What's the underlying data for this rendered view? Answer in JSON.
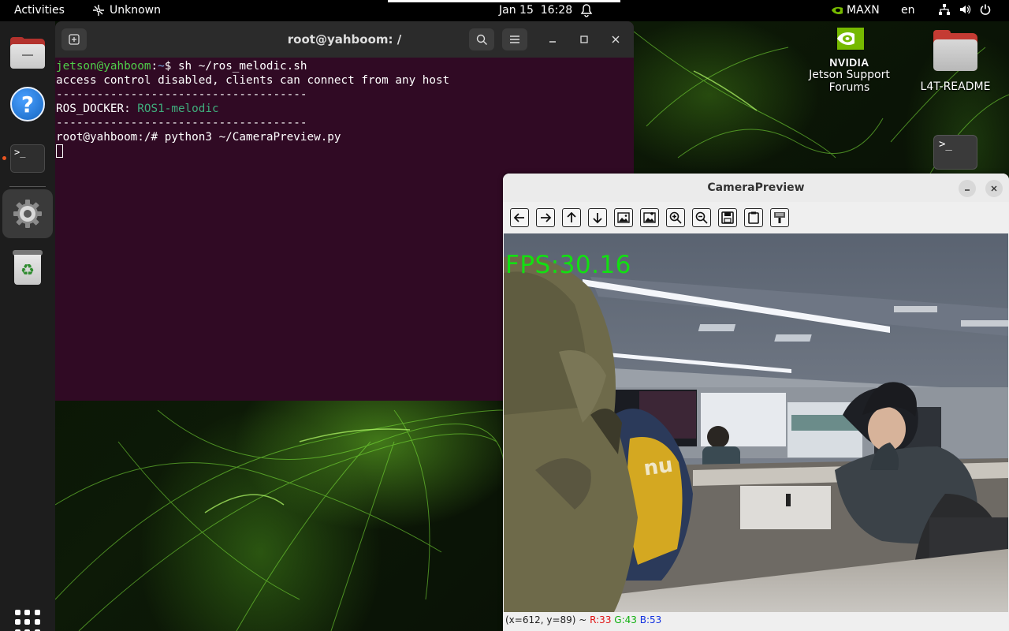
{
  "topbar": {
    "activities": "Activities",
    "network_label": "Unknown",
    "date": "Jan 15",
    "time": "16:28",
    "power_mode": "MAXN",
    "language": "en",
    "icons": [
      "network-icon",
      "bell-icon",
      "nvidia-icon",
      "network-wired-icon",
      "volume-icon",
      "power-icon"
    ]
  },
  "dock": {
    "items": [
      {
        "name": "files",
        "icon": "folder-icon"
      },
      {
        "name": "help",
        "icon": "help-icon"
      },
      {
        "name": "terminal",
        "icon": "terminal-icon",
        "running": true
      },
      {
        "name": "settings",
        "icon": "gear-icon",
        "running": true,
        "active": true
      },
      {
        "name": "trash",
        "icon": "trash-icon"
      }
    ],
    "apps_icon": "show-applications-icon"
  },
  "desktop": {
    "icons": [
      {
        "label_line1": "Jetson Support",
        "label_line2": "Forums",
        "logo_text": "NVIDIA",
        "icon": "nvidia-icon"
      },
      {
        "label": "L4T-README",
        "icon": "folder-icon"
      },
      {
        "label": "",
        "icon": "terminal-icon"
      }
    ]
  },
  "terminal": {
    "title": "root@yahboom: /",
    "lines": {
      "l1_user": "jetson@yahboom",
      "l1_sep": ":",
      "l1_path": "~",
      "l1_cmd": "$ sh ~/ros_melodic.sh",
      "l2": "access control disabled, clients can connect from any host",
      "l3": "-------------------------------------",
      "l4_key": "ROS_DOCKER: ",
      "l4_val": "ROS1-melodic",
      "l5": "-------------------------------------",
      "l6": "root@yahboom:/# python3 ~/CameraPreview.py"
    }
  },
  "camera": {
    "title": "CameraPreview",
    "fps_overlay": "FPS:30.16",
    "toolbar": [
      "arrow-left-icon",
      "arrow-right-icon",
      "arrow-up-icon",
      "arrow-down-icon",
      "image-icon",
      "image-settings-icon",
      "zoom-in-icon",
      "zoom-out-icon",
      "save-icon",
      "clipboard-icon",
      "properties-icon"
    ],
    "status": {
      "coords": "(x=612, y=89) ~ ",
      "r": "R:33",
      "g": "G:43",
      "b": "B:53"
    }
  }
}
